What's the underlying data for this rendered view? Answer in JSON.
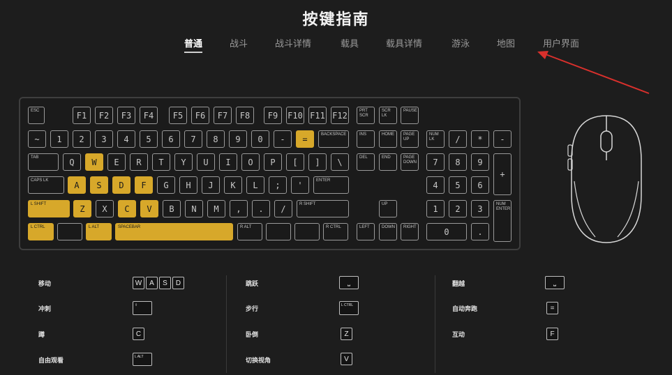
{
  "title": "按键指南",
  "tabs": [
    {
      "label": "普通",
      "active": true
    },
    {
      "label": "战斗"
    },
    {
      "label": "战斗详情"
    },
    {
      "label": "载具"
    },
    {
      "label": "载具详情"
    },
    {
      "label": "游泳"
    },
    {
      "label": "地图"
    },
    {
      "label": "用户界面"
    }
  ],
  "colors": {
    "highlight": "#d7a82a",
    "arrow": "#d9302c",
    "background": "#1d1d1d"
  },
  "keyboard": {
    "esc": "ESC",
    "f1": "F1",
    "f2": "F2",
    "f3": "F3",
    "f4": "F4",
    "f5": "F5",
    "f6": "F6",
    "f7": "F7",
    "f8": "F8",
    "f9": "F9",
    "f10": "F10",
    "f11": "F11",
    "f12": "F12",
    "prtscr": "PRT\nSCR",
    "scrlk": "SCR\nLK",
    "pause": "PAUSE",
    "tilde": "~",
    "n1": "1",
    "n2": "2",
    "n3": "3",
    "n4": "4",
    "n5": "5",
    "n6": "6",
    "n7": "7",
    "n8": "8",
    "n9": "9",
    "n0": "0",
    "minus": "-",
    "equals": "=",
    "backspace": "BACKSPACE",
    "ins": "INS",
    "home": "HOME",
    "pgup": "PAGE\nUP",
    "numlk": "NUM\nLK",
    "npdiv": "/",
    "npmul": "*",
    "npminus": "-",
    "tab": "TAB",
    "q": "Q",
    "w": "W",
    "e": "E",
    "r": "R",
    "t": "T",
    "y": "Y",
    "u": "U",
    "i": "I",
    "o": "O",
    "p": "P",
    "lbracket": "[",
    "rbracket": "]",
    "backslash": "\\",
    "del": "DEL",
    "end": "END",
    "pgdn": "PAGE\nDOWN",
    "np7": "7",
    "np8": "8",
    "np9": "9",
    "npplus": "+",
    "caps": "CAPS LK",
    "a": "A",
    "s": "S",
    "d": "D",
    "f": "F",
    "g": "G",
    "h": "H",
    "j": "J",
    "k": "K",
    "l": "L",
    "semicolon": ";",
    "quote": "'",
    "enter": "ENTER",
    "np4": "4",
    "np5": "5",
    "np6": "6",
    "lshift": "L SHIFT",
    "z": "Z",
    "x": "X",
    "c": "C",
    "v": "V",
    "b": "B",
    "n": "N",
    "m": "M",
    "comma": ",",
    "period": ".",
    "slash": "/",
    "rshift": "R SHIFT",
    "up": "UP",
    "np1": "1",
    "np2": "2",
    "np3": "3",
    "npenter": "NUM\nENTER",
    "lctrl": "L CTRL",
    "lalt": "L ALT",
    "space": "SPACEBAR",
    "ralt": "R ALT",
    "rctrl": "R CTRL",
    "left": "LEFT",
    "down": "DOWN",
    "right": "RIGHT",
    "np0": "0",
    "npdot": "."
  },
  "bindings": {
    "col1": [
      {
        "label": "移动",
        "keys": [
          "W",
          "A",
          "S",
          "D"
        ]
      },
      {
        "label": "冲刺",
        "keys": [
          "⇧"
        ]
      },
      {
        "label": "蹲",
        "keys": [
          "C"
        ]
      },
      {
        "label": "自由观看",
        "keys": [
          "L ALT"
        ]
      }
    ],
    "col2": [
      {
        "label": "跳跃",
        "keys": [
          "⎵"
        ]
      },
      {
        "label": "步行",
        "keys": [
          "L CTRL"
        ]
      },
      {
        "label": "卧倒",
        "keys": [
          "Z"
        ]
      },
      {
        "label": "切换视角",
        "keys": [
          "V"
        ]
      }
    ],
    "col3": [
      {
        "label": "翻越",
        "keys": [
          "⎵"
        ]
      },
      {
        "label": "自动奔跑",
        "keys": [
          "="
        ]
      },
      {
        "label": "互动",
        "keys": [
          "F"
        ]
      }
    ]
  }
}
